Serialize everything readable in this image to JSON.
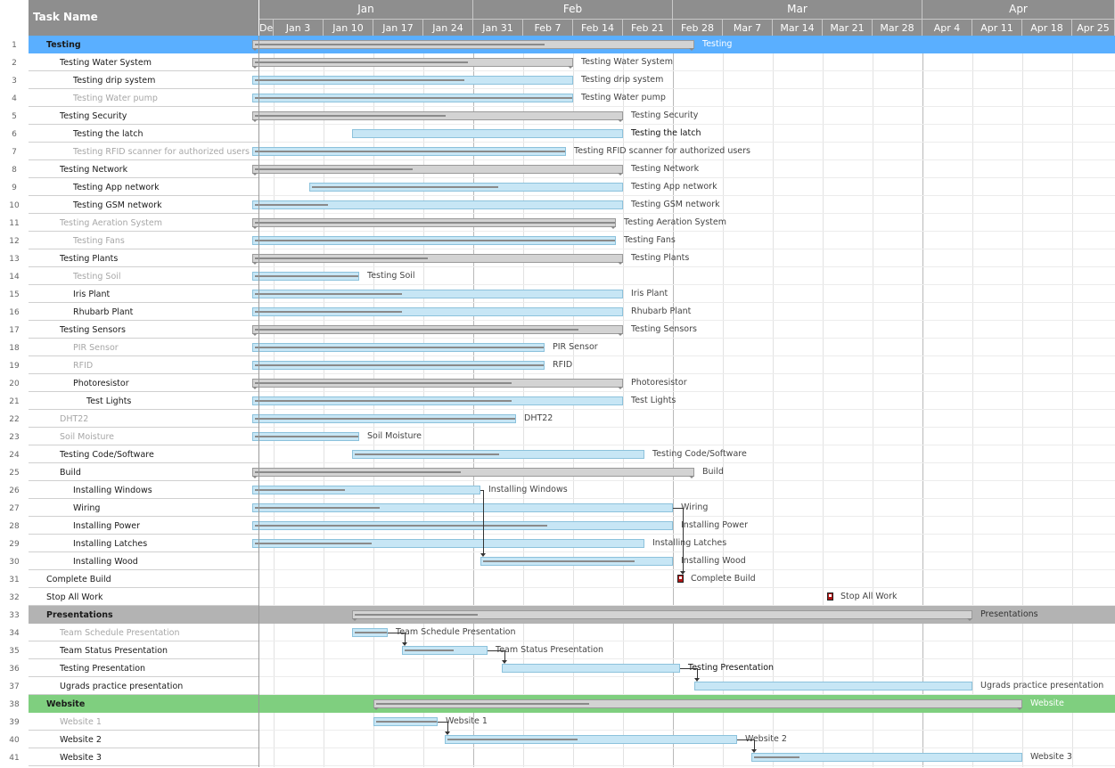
{
  "header": {
    "task_name_label": "Task Name",
    "months": [
      {
        "label": "Jan",
        "weeks": [
          0,
          5
        ]
      },
      {
        "label": "Feb",
        "weeks": [
          5,
          9
        ]
      },
      {
        "label": "Mar",
        "weeks": [
          9,
          14
        ]
      },
      {
        "label": "Apr",
        "weeks": [
          14,
          18
        ]
      }
    ],
    "weeks": [
      "De",
      "Jan 3",
      "Jan 10",
      "Jan 17",
      "Jan 24",
      "Jan 31",
      "Feb 7",
      "Feb 14",
      "Feb 21",
      "Feb 28",
      "Mar 7",
      "Mar 14",
      "Mar 21",
      "Mar 28",
      "Apr 4",
      "Apr 11",
      "Apr 18",
      "Apr 25"
    ]
  },
  "colors": {
    "header_bg": "#8e8e8e",
    "band_testing": "#5aafff",
    "band_presentations": "#b3b3b3",
    "band_website": "#7fcf7f",
    "task_bar": "#c7e6f5",
    "summary_bar": "#d3d3d3",
    "milestone": "#b01616",
    "label_active": "#1a1a1a",
    "label_muted": "#a7a7a7"
  },
  "tasks": [
    {
      "id": 1,
      "name": "Testing",
      "level": 0,
      "style": "band",
      "band": "testing",
      "type": "summary",
      "start": "Dec 31",
      "end": "Mar 3",
      "progress": 0.66,
      "label": "Testing"
    },
    {
      "id": 2,
      "name": "Testing Water System",
      "level": 1,
      "style": "active",
      "type": "summary",
      "start": "Dec 31",
      "end": "Feb 14",
      "progress": 0.67,
      "label": "Testing Water System"
    },
    {
      "id": 3,
      "name": "Testing drip system",
      "level": 2,
      "style": "active",
      "type": "task",
      "start": "Dec 31",
      "end": "Feb 14",
      "progress": 0.66,
      "label": "Testing drip system"
    },
    {
      "id": 4,
      "name": "Testing Water pump",
      "level": 2,
      "style": "muted",
      "type": "task",
      "start": "Dec 31",
      "end": "Feb 14",
      "progress": 1.0,
      "label": "Testing Water pump"
    },
    {
      "id": 5,
      "name": "Testing Security",
      "level": 1,
      "style": "active",
      "type": "summary",
      "start": "Dec 31",
      "end": "Feb 21",
      "progress": 0.52,
      "label": "Testing Security"
    },
    {
      "id": 6,
      "name": "Testing the latch",
      "level": 2,
      "style": "active",
      "type": "task",
      "start": "Jan 14",
      "end": "Feb 21",
      "progress": 0,
      "label": "Testing the latch"
    },
    {
      "id": 7,
      "name": "Testing RFID scanner for authorized users",
      "level": 2,
      "style": "muted",
      "type": "task",
      "start": "Dec 31",
      "end": "Feb 13",
      "progress": 1.0,
      "label": "Testing RFID scanner for authorized users"
    },
    {
      "id": 8,
      "name": "Testing Network",
      "level": 1,
      "style": "active",
      "type": "summary",
      "start": "Dec 31",
      "end": "Feb 21",
      "progress": 0.43,
      "label": "Testing Network"
    },
    {
      "id": 9,
      "name": "Testing App network",
      "level": 2,
      "style": "active",
      "type": "task",
      "start": "Jan 8",
      "end": "Feb 21",
      "progress": 0.6,
      "label": "Testing App network"
    },
    {
      "id": 10,
      "name": "Testing GSM network",
      "level": 2,
      "style": "active",
      "type": "task",
      "start": "Dec 31",
      "end": "Feb 21",
      "progress": 0.2,
      "label": "Testing GSM network"
    },
    {
      "id": 11,
      "name": "Testing Aeration System",
      "level": 1,
      "style": "muted",
      "type": "summary",
      "start": "Dec 31",
      "end": "Feb 20",
      "progress": 1.0,
      "label": "Testing Aeration System"
    },
    {
      "id": 12,
      "name": "Testing Fans",
      "level": 2,
      "style": "muted",
      "type": "task",
      "start": "Dec 31",
      "end": "Feb 20",
      "progress": 1.0,
      "label": "Testing Fans"
    },
    {
      "id": 13,
      "name": "Testing Plants",
      "level": 1,
      "style": "active",
      "type": "summary",
      "start": "Dec 31",
      "end": "Feb 21",
      "progress": 0.47,
      "label": "Testing Plants"
    },
    {
      "id": 14,
      "name": "Testing Soil",
      "level": 2,
      "style": "muted",
      "type": "task",
      "start": "Dec 31",
      "end": "Jan 15",
      "progress": 1.0,
      "label": "Testing Soil"
    },
    {
      "id": 15,
      "name": "Iris Plant",
      "level": 2,
      "style": "active",
      "type": "task",
      "start": "Dec 31",
      "end": "Feb 21",
      "progress": 0.4,
      "label": "Iris Plant"
    },
    {
      "id": 16,
      "name": "Rhubarb Plant",
      "level": 2,
      "style": "active",
      "type": "task",
      "start": "Dec 31",
      "end": "Feb 21",
      "progress": 0.4,
      "label": "Rhubarb Plant"
    },
    {
      "id": 17,
      "name": "Testing Sensors",
      "level": 1,
      "style": "active",
      "type": "summary",
      "start": "Dec 31",
      "end": "Feb 21",
      "progress": 0.88,
      "label": "Testing Sensors"
    },
    {
      "id": 18,
      "name": "PIR Sensor",
      "level": 2,
      "style": "muted",
      "type": "task",
      "start": "Dec 31",
      "end": "Feb 10",
      "progress": 1.0,
      "label": "PIR Sensor"
    },
    {
      "id": 19,
      "name": "RFID",
      "level": 2,
      "style": "muted",
      "type": "task",
      "start": "Dec 31",
      "end": "Feb 10",
      "progress": 1.0,
      "label": "RFID"
    },
    {
      "id": 20,
      "name": "Photoresistor",
      "level": 2,
      "style": "active",
      "type": "summary",
      "start": "Dec 31",
      "end": "Feb 21",
      "progress": 0.7,
      "label": "Photoresistor"
    },
    {
      "id": 21,
      "name": "Test Lights",
      "level": 3,
      "style": "active",
      "type": "task",
      "start": "Dec 31",
      "end": "Feb 21",
      "progress": 0.7,
      "label": "Test Lights"
    },
    {
      "id": 22,
      "name": "DHT22",
      "level": 1,
      "style": "muted",
      "type": "task",
      "start": "Dec 31",
      "end": "Feb 6",
      "progress": 1.0,
      "label": "DHT22"
    },
    {
      "id": 23,
      "name": "Soil Moisture",
      "level": 1,
      "style": "muted",
      "type": "task",
      "start": "Dec 31",
      "end": "Jan 15",
      "progress": 1.0,
      "label": "Soil Moisture"
    },
    {
      "id": 24,
      "name": "Testing Code/Software",
      "level": 1,
      "style": "active",
      "type": "task",
      "start": "Jan 14",
      "end": "Feb 24",
      "progress": 0.5,
      "label": "Testing Code/Software"
    },
    {
      "id": 25,
      "name": "Build",
      "level": 1,
      "style": "active",
      "type": "summary",
      "start": "Dec 31",
      "end": "Mar 3",
      "progress": 0.47,
      "label": "Build"
    },
    {
      "id": 26,
      "name": "Installing Windows",
      "level": 2,
      "style": "active",
      "type": "task",
      "start": "Dec 31",
      "end": "Feb 1",
      "progress": 0.4,
      "label": "Installing Windows"
    },
    {
      "id": 27,
      "name": "Wiring",
      "level": 2,
      "style": "active",
      "type": "task",
      "start": "Dec 31",
      "end": "Feb 28",
      "progress": 0.3,
      "label": "Wiring"
    },
    {
      "id": 28,
      "name": "Installing Power",
      "level": 2,
      "style": "active",
      "type": "task",
      "start": "Dec 31",
      "end": "Feb 28",
      "progress": 0.7,
      "label": "Installing Power"
    },
    {
      "id": 29,
      "name": "Installing Latches",
      "level": 2,
      "style": "active",
      "type": "task",
      "start": "Dec 31",
      "end": "Feb 24",
      "progress": 0.3,
      "label": "Installing Latches"
    },
    {
      "id": 30,
      "name": "Installing Wood",
      "level": 2,
      "style": "active",
      "type": "task",
      "start": "Feb 1",
      "end": "Feb 28",
      "progress": 0.8,
      "label": "Installing Wood"
    },
    {
      "id": 31,
      "name": "Complete Build",
      "level": 0,
      "style": "active",
      "type": "milestone",
      "start": "Mar 1",
      "end": "Mar 1",
      "progress": 0,
      "label": "Complete Build"
    },
    {
      "id": 32,
      "name": "Stop All Work",
      "level": 0,
      "style": "active",
      "type": "milestone",
      "start": "Mar 22",
      "end": "Mar 22",
      "progress": 0,
      "label": "Stop All Work"
    },
    {
      "id": 33,
      "name": "Presentations",
      "level": 0,
      "style": "band",
      "band": "presentations",
      "type": "summary",
      "start": "Jan 14",
      "end": "Apr 11",
      "progress": 0.2,
      "label": "Presentations"
    },
    {
      "id": 34,
      "name": "Team Schedule Presentation",
      "level": 1,
      "style": "muted",
      "type": "task",
      "start": "Jan 14",
      "end": "Jan 19",
      "progress": 1.0,
      "label": "Team Schedule Presentation"
    },
    {
      "id": 35,
      "name": "Team Status Presentation",
      "level": 1,
      "style": "active",
      "type": "task",
      "start": "Jan 21",
      "end": "Feb 2",
      "progress": 0.6,
      "label": "Team Status Presentation"
    },
    {
      "id": 36,
      "name": "Testing Presentation",
      "level": 1,
      "style": "active",
      "type": "task",
      "start": "Feb 4",
      "end": "Mar 1",
      "progress": 0,
      "label": "Testing Presentation"
    },
    {
      "id": 37,
      "name": "Ugrads practice presentation",
      "level": 1,
      "style": "active",
      "type": "task",
      "start": "Mar 3",
      "end": "Apr 11",
      "progress": 0,
      "label": "Ugrads practice presentation"
    },
    {
      "id": 38,
      "name": "Website",
      "level": 0,
      "style": "band",
      "band": "website",
      "type": "summary",
      "start": "Jan 17",
      "end": "Apr 18",
      "progress": 0.33,
      "label": "Website"
    },
    {
      "id": 39,
      "name": "Website 1",
      "level": 1,
      "style": "muted",
      "type": "task",
      "start": "Jan 17",
      "end": "Jan 26",
      "progress": 1.0,
      "label": "Website 1"
    },
    {
      "id": 40,
      "name": "Website 2",
      "level": 1,
      "style": "active",
      "type": "task",
      "start": "Jan 27",
      "end": "Mar 9",
      "progress": 0.45,
      "label": "Website 2"
    },
    {
      "id": 41,
      "name": "Website 3",
      "level": 1,
      "style": "active",
      "type": "task",
      "start": "Mar 11",
      "end": "Apr 18",
      "progress": 0.17,
      "label": "Website 3"
    }
  ],
  "dependencies": [
    {
      "from": 26,
      "to": 30
    },
    {
      "from": 27,
      "to": 31
    },
    {
      "from": 34,
      "to": 35
    },
    {
      "from": 35,
      "to": 36
    },
    {
      "from": 36,
      "to": 37
    },
    {
      "from": 39,
      "to": 40
    },
    {
      "from": 40,
      "to": 41
    }
  ]
}
